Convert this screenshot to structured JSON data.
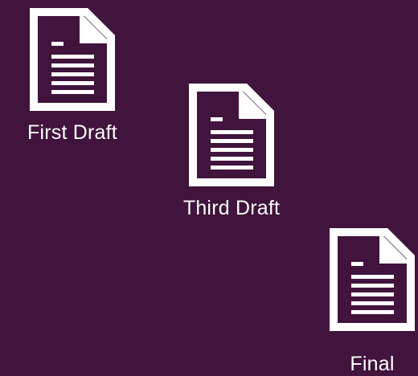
{
  "desktop": {
    "background_color": "#40143c",
    "files": [
      {
        "label": "First Draft",
        "icon": "document-icon"
      },
      {
        "label": "Third Draft",
        "icon": "document-icon"
      },
      {
        "label": "Final",
        "icon": "document-icon"
      }
    ]
  }
}
